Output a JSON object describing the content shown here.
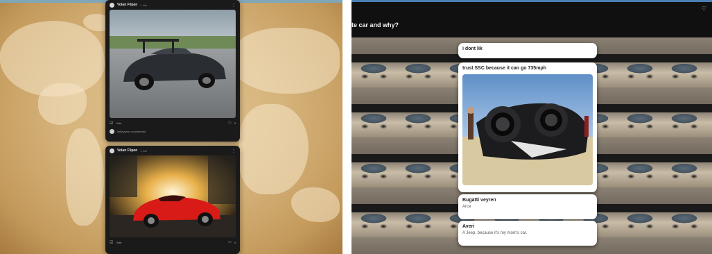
{
  "left_feed": {
    "posts": [
      {
        "author": "Volan Flipen",
        "time": "1 min",
        "image_icon": "silver-supercar-photo",
        "like_label": "Vote",
        "comment_count": "3",
        "footer_text": "hellbyyeno commented"
      },
      {
        "author": "Volan Flipen",
        "time": "1 min",
        "image_icon": "red-roadster-photo",
        "like_label": "Vote",
        "comment_count": "0"
      }
    ]
  },
  "right_chat": {
    "question": "te car and why?",
    "heart_icon": "heart-icon",
    "answers": [
      {
        "title": "i dont lik"
      },
      {
        "title": "trust SSC because it can go 735mph",
        "image_icon": "jet-car-photo"
      },
      {
        "title": "Bugatti veyren",
        "body": "Arce"
      },
      {
        "title": "Averi",
        "body": "A Jeep, because it's my mom's car."
      }
    ]
  },
  "colors": {
    "map_background": "#d6b47c",
    "card_dark": "#1a1a1b",
    "header_dark": "#101010",
    "accent_blue": "#4a7fb6"
  }
}
